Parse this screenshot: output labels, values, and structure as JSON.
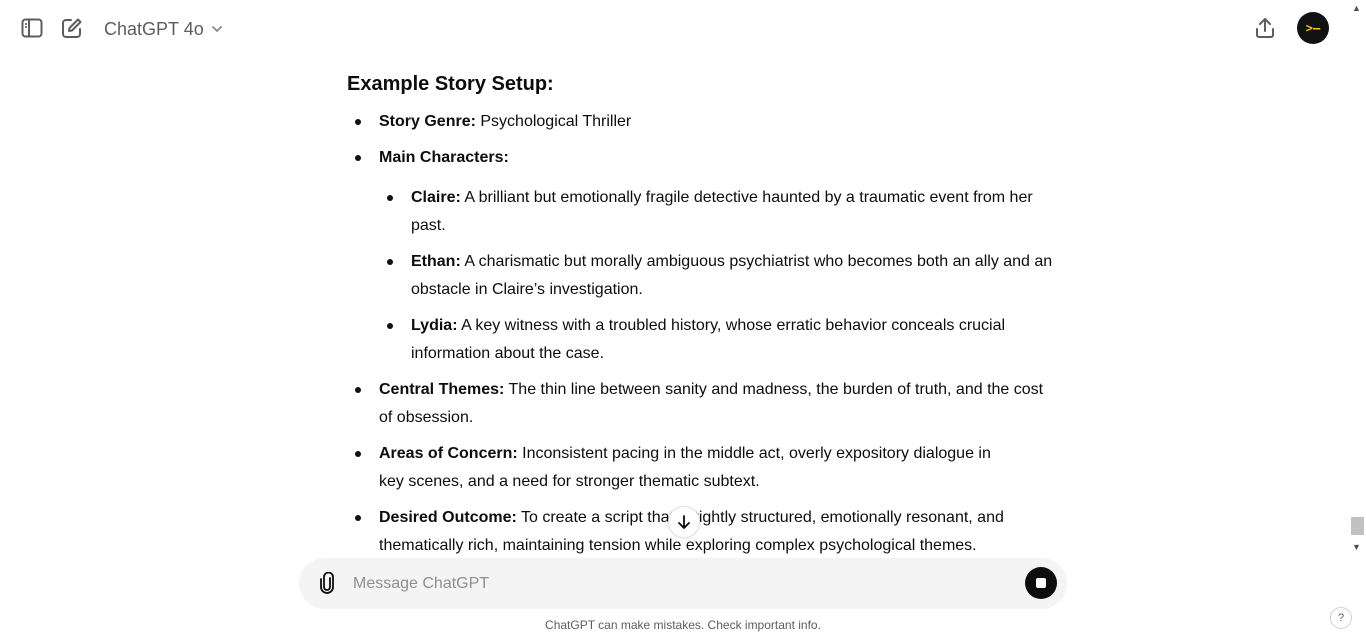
{
  "header": {
    "model_label": "ChatGPT 4o",
    "avatar_text": ">—"
  },
  "story": {
    "heading": "Example Story Setup:",
    "genre": {
      "label": "Story Genre:",
      "text": " Psychological Thriller"
    },
    "characters_label": "Main Characters:",
    "characters": [
      {
        "label": "Claire:",
        "text": " A brilliant but emotionally fragile detective haunted by a traumatic event from her past."
      },
      {
        "label": "Ethan:",
        "text": " A charismatic but morally ambiguous psychiatrist who becomes both an ally and an obstacle in Claire’s investigation."
      },
      {
        "label": "Lydia:",
        "text": " A key witness with a troubled history, whose erratic behavior conceals crucial information about the case."
      }
    ],
    "themes": {
      "label": "Central Themes:",
      "text": " The thin line between sanity and madness, the burden of truth, and the cost of obsession."
    },
    "concerns": {
      "label": "Areas of Concern:",
      "text": " Inconsistent pacing in the middle act, overly expository dialogue in key scenes, and a need for stronger thematic subtext."
    },
    "outcome": {
      "label": "Desired Outcome:",
      "text": " To create a script that is tightly structured, emotionally resonant, and thematically rich, maintaining tension while exploring complex psychological themes."
    }
  },
  "composer": {
    "placeholder": "Message ChatGPT"
  },
  "footer": {
    "disclaimer": "ChatGPT can make mistakes. Check important info.",
    "help_label": "?"
  },
  "icons": [
    "sidebar-toggle-icon",
    "new-chat-icon",
    "chevron-down-icon",
    "share-icon",
    "arrow-down-icon",
    "paperclip-icon",
    "stop-icon",
    "question-icon"
  ]
}
